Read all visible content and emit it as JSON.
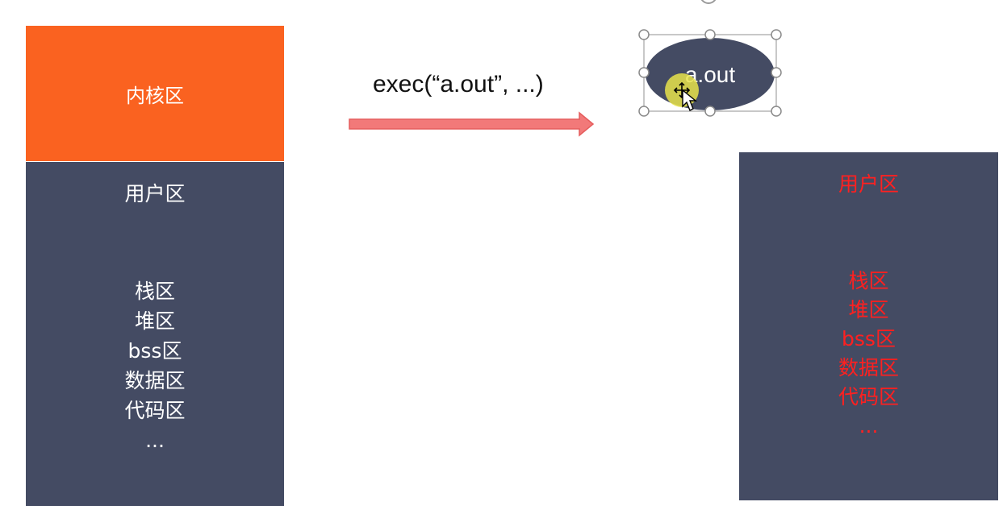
{
  "left_memory": {
    "kernel_label": "内核区",
    "user_label": "用户区",
    "segments": [
      "栈区",
      "堆区",
      "bss区",
      "数据区",
      "代码区",
      "..."
    ]
  },
  "exec_call": {
    "label": "exec(“a.out”, ...)"
  },
  "program_shape": {
    "label": "a.out"
  },
  "right_memory": {
    "user_label": "用户区",
    "segments": [
      "栈区",
      "堆区",
      "bss区",
      "数据区",
      "代码区",
      "..."
    ]
  },
  "colors": {
    "kernel": "#fa6220",
    "user": "#444b63",
    "highlight_text": "#ff2020",
    "arrow_fill": "#f27979"
  }
}
